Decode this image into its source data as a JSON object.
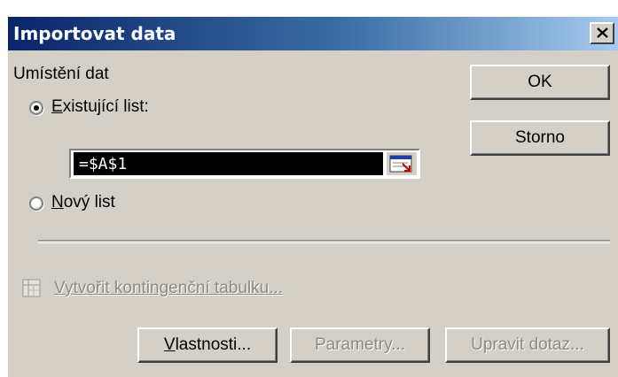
{
  "dialog": {
    "title": "Importovat data",
    "close_icon": "close-icon"
  },
  "placement": {
    "group_label": "Umístění dat",
    "existing_sheet": {
      "label_first": "E",
      "label_rest": "xistující list:",
      "selected": true
    },
    "reference_value": "=$A$1",
    "new_sheet": {
      "label_first": "N",
      "label_rest": "ový list",
      "selected": false
    }
  },
  "pivot": {
    "icon": "pivot-table-icon",
    "label": "Vytvořit kontingenční tabulku...",
    "enabled": false
  },
  "buttons": {
    "ok": "OK",
    "cancel": "Storno",
    "properties_first": "V",
    "properties_rest": "lastnosti...",
    "parameters": "Parametry...",
    "edit_query": "Upravit dotaz..."
  },
  "colors": {
    "title_start": "#0a246a",
    "title_end": "#a6caf0",
    "dialog_face": "#d4d0c8",
    "disabled_text": "#8c8a84"
  }
}
